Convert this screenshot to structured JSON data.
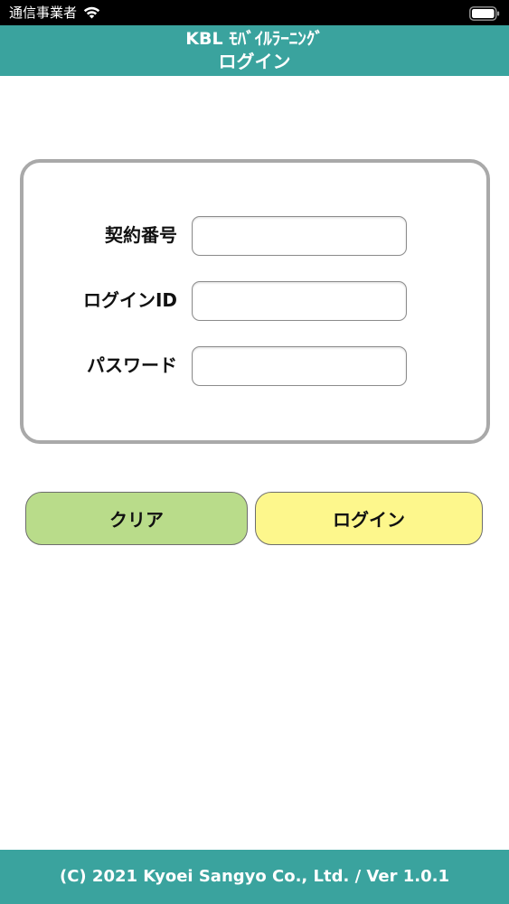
{
  "status_bar": {
    "carrier": "通信事業者",
    "wifi_icon": "wifi-icon",
    "battery_icon": "battery-icon"
  },
  "header": {
    "app_name": "KBL ﾓﾊﾞｲﾙﾗｰﾆﾝｸﾞ",
    "title": "ログイン"
  },
  "form": {
    "contract_number_label": "契約番号",
    "contract_number_value": "",
    "login_id_label": "ログインID",
    "login_id_value": "",
    "password_label": "パスワード",
    "password_value": ""
  },
  "buttons": {
    "clear_label": "クリア",
    "login_label": "ログイン"
  },
  "footer": {
    "copyright": "(C) 2021 Kyoei Sangyo Co., Ltd. / Ver 1.0.1"
  },
  "colors": {
    "header_bg": "#3aa39e",
    "clear_button_bg": "#b9dc8a",
    "login_button_bg": "#fdf78c",
    "panel_border": "#a9a9a9"
  }
}
